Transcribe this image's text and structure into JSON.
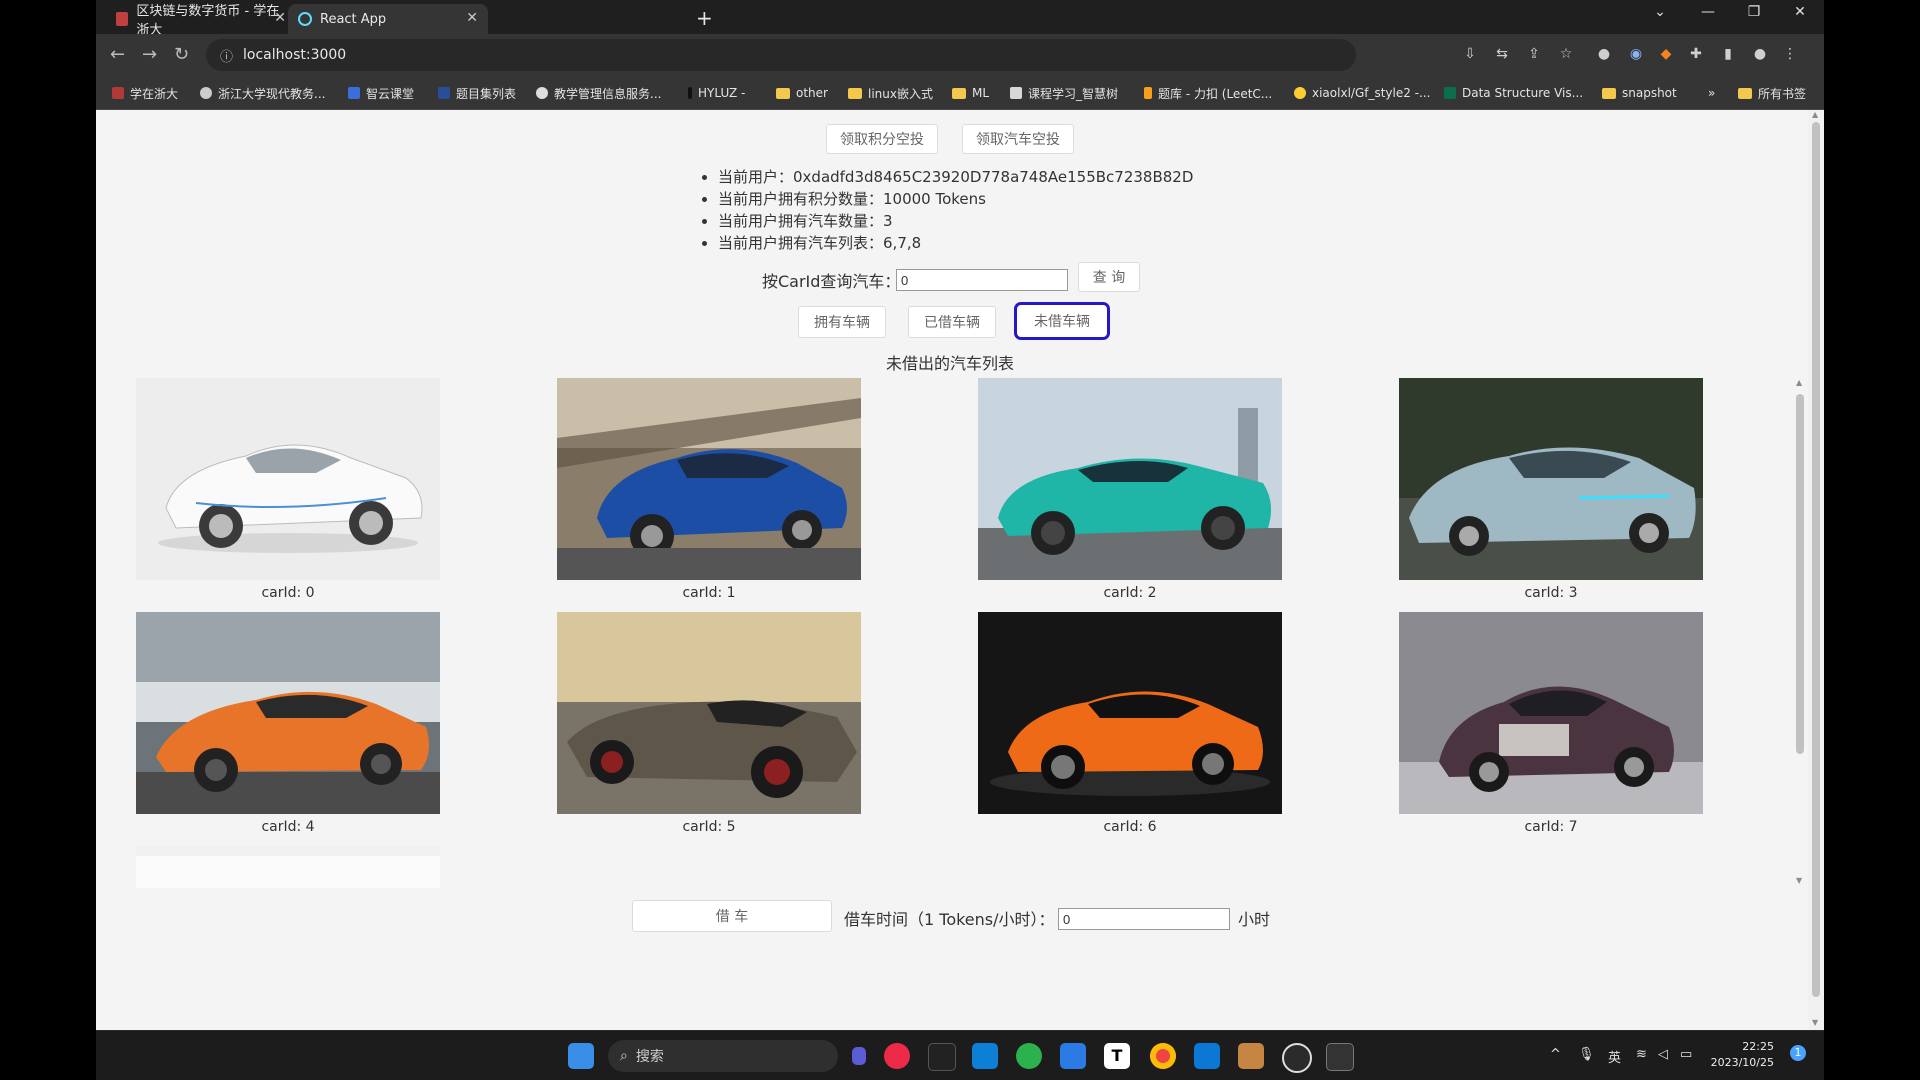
{
  "browser": {
    "tabs": [
      {
        "title": "区块链与数字货币 - 学在浙大",
        "active": false
      },
      {
        "title": "React App",
        "active": true
      }
    ],
    "new_tab": "+",
    "address": "localhost:3000"
  },
  "bookmarks": [
    {
      "label": "学在浙大",
      "icon": "zju-icon"
    },
    {
      "label": "浙江大学现代教务...",
      "icon": "globe-icon"
    },
    {
      "label": "智云课堂",
      "icon": "cmc-icon"
    },
    {
      "label": "题目集列表",
      "icon": "pta-icon"
    },
    {
      "label": "教学管理信息服务...",
      "icon": "zju-seal-icon"
    },
    {
      "label": "HYLUZ -",
      "icon": "dark-icon"
    },
    {
      "label": "other",
      "icon": "folder-icon"
    },
    {
      "label": "linux嵌入式",
      "icon": "folder-icon"
    },
    {
      "label": "ML",
      "icon": "folder-icon"
    },
    {
      "label": "课程学习_智慧树",
      "icon": "zhs-icon"
    },
    {
      "label": "题库 - 力扣 (LeetC...",
      "icon": "leetcode-icon"
    },
    {
      "label": "xiaolxl/Gf_style2 -...",
      "icon": "hf-icon"
    },
    {
      "label": "Data Structure Vis...",
      "icon": "usf-icon"
    },
    {
      "label": "snapshot",
      "icon": "folder-icon"
    }
  ],
  "bookmarks_more": "»",
  "bookmarks_all": "所有书签",
  "app": {
    "airdrop_points_label": "领取积分空投",
    "airdrop_car_label": "领取汽车空投",
    "info": [
      "当前用户：0xdadfd3d8465C23920D778a748Ae155Bc7238B82D",
      "当前用户拥有积分数量：10000 Tokens",
      "当前用户拥有汽车数量：3",
      "当前用户拥有汽车列表：6,7,8"
    ],
    "query_label": "按CarId查询汽车：",
    "query_value": "0",
    "query_button": "查 询",
    "filter_owned": "拥有车辆",
    "filter_borrowed": "已借车辆",
    "filter_available": "未借车辆",
    "list_title": "未借出的汽车列表",
    "cars": [
      {
        "caption": "carId: 0",
        "palette": "white"
      },
      {
        "caption": "carId: 1",
        "palette": "blue"
      },
      {
        "caption": "carId: 2",
        "palette": "teal"
      },
      {
        "caption": "carId: 3",
        "palette": "silver-concept"
      },
      {
        "caption": "carId: 4",
        "palette": "orange-sea"
      },
      {
        "caption": "carId: 5",
        "palette": "bronze"
      },
      {
        "caption": "carId: 6",
        "palette": "orange-dark"
      },
      {
        "caption": "carId: 7",
        "palette": "purple"
      }
    ],
    "borrow_button": "借 车",
    "borrow_time_label": "借车时间（1 Tokens/小时）：",
    "borrow_time_value": "0",
    "hours_unit": "小时"
  },
  "taskbar": {
    "search_placeholder": "搜索",
    "ime": "英",
    "time": "22:25",
    "date": "2023/10/25",
    "notification_count": "1"
  }
}
